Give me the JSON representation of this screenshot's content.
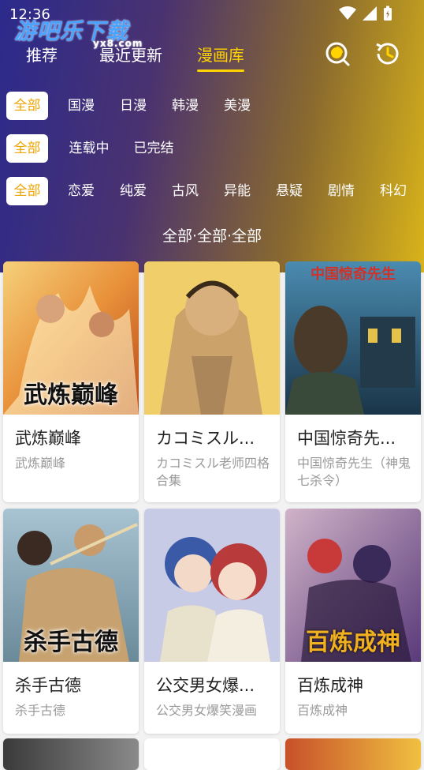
{
  "status": {
    "time": "12:36"
  },
  "watermark": {
    "text": "游吧乐下载",
    "sub": "yx8.com"
  },
  "tabs": [
    {
      "label": "推荐"
    },
    {
      "label": "最近更新"
    },
    {
      "label": "漫画库"
    }
  ],
  "filters": {
    "region": [
      "全部",
      "国漫",
      "日漫",
      "韩漫",
      "美漫"
    ],
    "status": [
      "全部",
      "连载中",
      "已完结"
    ],
    "genre": [
      "全部",
      "恋爱",
      "纯爱",
      "古风",
      "异能",
      "悬疑",
      "剧情",
      "科幻"
    ]
  },
  "section_title": "全部·全部·全部",
  "comics": [
    {
      "name": "武炼巅峰",
      "desc": "武炼巅峰",
      "cover_text": "武炼巅峰",
      "colors": [
        "#e8913a",
        "#f6d07a"
      ]
    },
    {
      "name": "カコミスル...",
      "desc": "カコミスル老师四格合集",
      "cover_text": "",
      "colors": [
        "#e2b83d",
        "#f4d67a"
      ]
    },
    {
      "name": "中国惊奇先...",
      "desc": "中国惊奇先生（神鬼七杀令）",
      "cover_text": "中国惊奇先生",
      "colors": [
        "#2a5a78",
        "#4a8bb0"
      ]
    },
    {
      "name": "杀手古德",
      "desc": "杀手古德",
      "cover_text": "杀手古德",
      "colors": [
        "#6a8a9a",
        "#c7a270"
      ]
    },
    {
      "name": "公交男女爆...",
      "desc": "公交男女爆笑漫画",
      "cover_text": "",
      "colors": [
        "#c8cbe6",
        "#f3d9c8"
      ]
    },
    {
      "name": "百炼成神",
      "desc": "百炼成神",
      "cover_text": "百炼成神",
      "colors": [
        "#6a4a8a",
        "#d0b3c8"
      ]
    }
  ]
}
